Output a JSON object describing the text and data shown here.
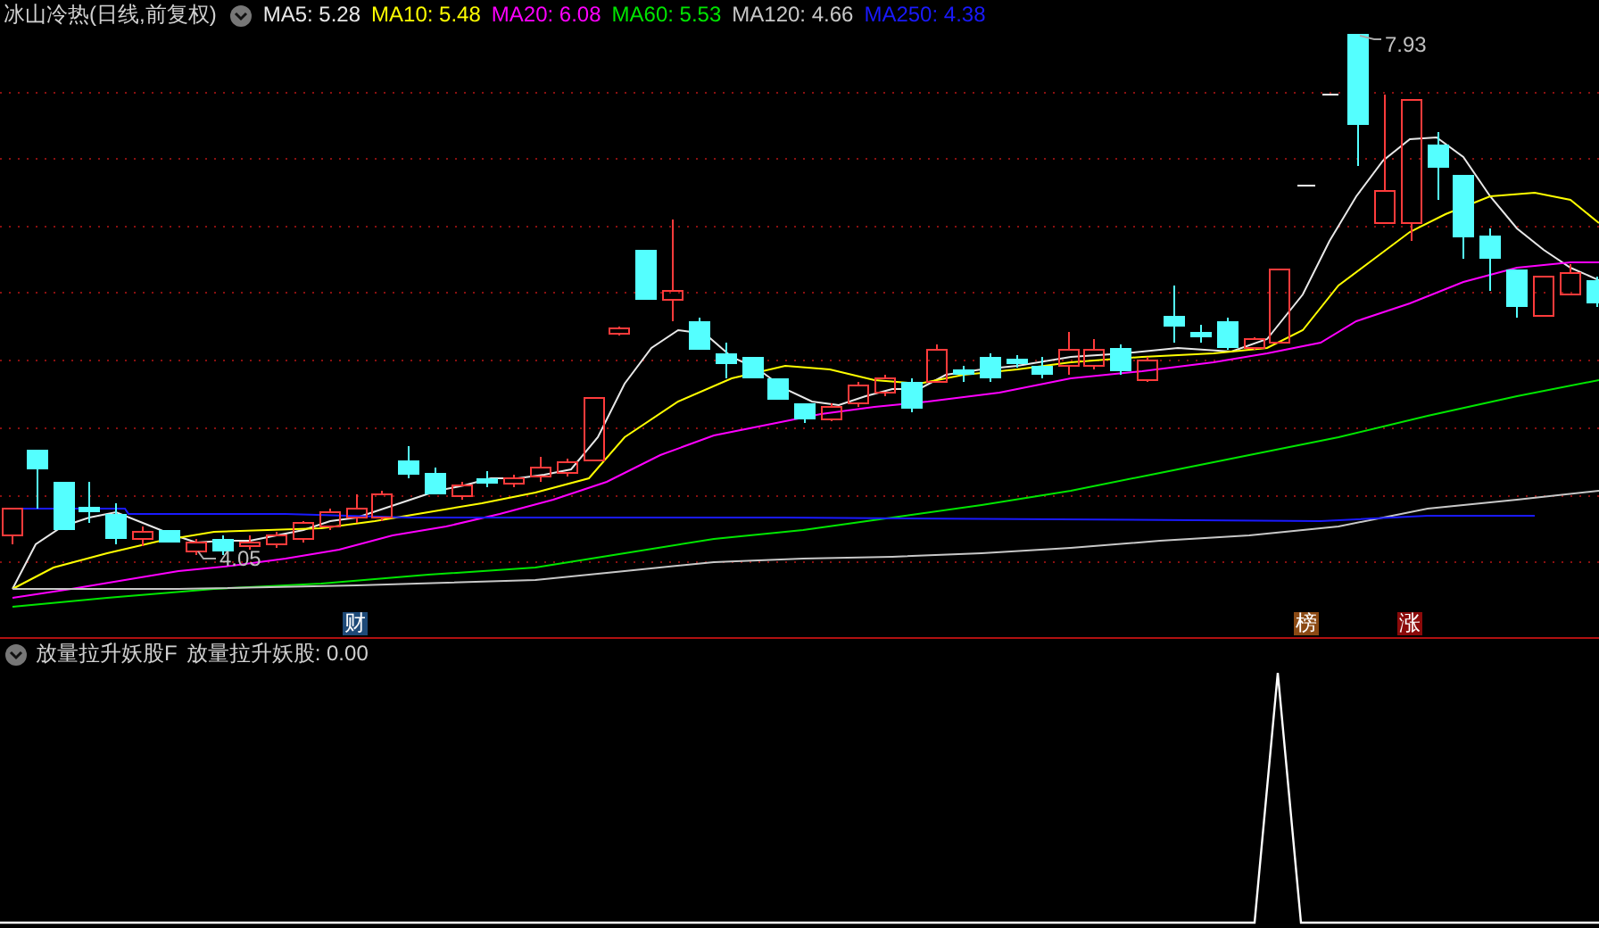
{
  "header": {
    "title": "冰山冷热(日线,前复权)",
    "moving_averages": [
      {
        "label": "MA5: 5.28",
        "color": "#e8e8e8"
      },
      {
        "label": "MA10: 5.48",
        "color": "#ffff00"
      },
      {
        "label": "MA20: 6.08",
        "color": "#ff00ff"
      },
      {
        "label": "MA60: 5.53",
        "color": "#00e600"
      },
      {
        "label": "MA120: 4.66",
        "color": "#c8c8c8"
      },
      {
        "label": "MA250: 4.38",
        "color": "#1a1aff"
      }
    ]
  },
  "price_chart": {
    "high_label": "7.93",
    "low_label": "4.05",
    "markers": [
      {
        "label": "财",
        "color": "#1e4a78"
      },
      {
        "label": "榜",
        "color": "#8b4a14"
      },
      {
        "label": "涨",
        "color": "#8b0a0a"
      }
    ]
  },
  "indicator_panel": {
    "title": "放量拉升妖股F",
    "reading": "放量拉升妖股: 0.00"
  }
}
